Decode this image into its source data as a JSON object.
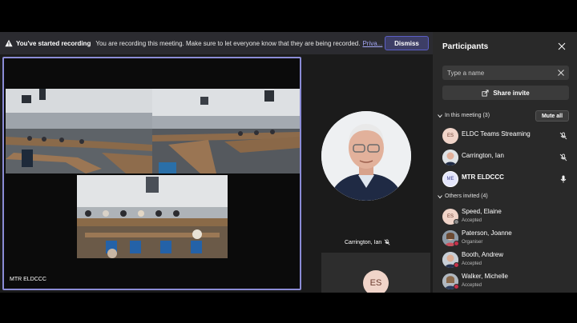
{
  "banner": {
    "title": "You've started recording",
    "message": "You are recording this meeting. Make sure to let everyone know that they are being recorded.",
    "link": "Priva...",
    "dismiss": "Dismiss"
  },
  "stage": {
    "main_tile_label": "MTR ELDCCC",
    "person_tile_name": "Carrington, Ian",
    "small_tile_initials": "ES"
  },
  "panel": {
    "title": "Participants",
    "search_placeholder": "Type a name",
    "share_invite": "Share invite",
    "in_meeting_label": "In this meeting (3)",
    "mute_all": "Mute all",
    "in_meeting": [
      {
        "initials": "ES",
        "name": "ELDC Teams Streaming",
        "mic": "off"
      },
      {
        "initials": "",
        "name": "Carrington, Ian",
        "mic": "off"
      },
      {
        "initials": "ME",
        "name": "MTR ELDCCC",
        "mic": "on"
      }
    ],
    "others_label": "Others invited (4)",
    "others": [
      {
        "initials": "ES",
        "name": "Speed, Elaine",
        "status": "Accepted"
      },
      {
        "initials": "",
        "name": "Paterson, Joanne",
        "status": "Organiser"
      },
      {
        "initials": "",
        "name": "Booth, Andrew",
        "status": "Accepted"
      },
      {
        "initials": "",
        "name": "Walker, Michelle",
        "status": "Accepted"
      }
    ]
  },
  "colors": {
    "accent": "#5b5fc7",
    "panel_bg": "#292929",
    "banner_bg": "#2b2b30"
  }
}
